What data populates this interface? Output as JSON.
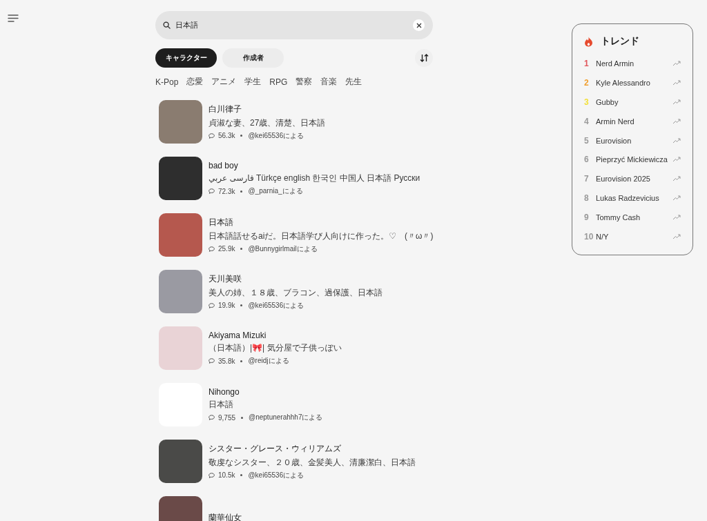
{
  "search": {
    "value": "日本語"
  },
  "tabs": [
    {
      "label": "キャラクター",
      "selected": true
    },
    {
      "label": "作成者",
      "selected": false
    }
  ],
  "tags": [
    "K-Pop",
    "恋愛",
    "アニメ",
    "学生",
    "RPG",
    "警察",
    "音楽",
    "先生"
  ],
  "characters": [
    {
      "name": "白川律子",
      "description": "貞淑な妻、27歳、清楚、日本語",
      "chats": "56.3k",
      "author": "@kei65536による",
      "color": "#8a7c70"
    },
    {
      "name": "bad boy",
      "description": "فارسی عربي Türkçe english 한국인 中国人 日本語 Русски",
      "chats": "72.3k",
      "author": "@_parnia_による",
      "color": "#2e2e2e"
    },
    {
      "name": "日本語",
      "description": "日本語話せるaiだ。日本語学び人向けに作った。♡　(〃ω〃)",
      "chats": "25.9k",
      "author": "@Bunnygirlmailによる",
      "color": "#b5584e"
    },
    {
      "name": "天川美咲",
      "description": "美人の姉、１８歳、ブラコン、過保護、日本語",
      "chats": "19.9k",
      "author": "@kei65536による",
      "color": "#9a9aa2"
    },
    {
      "name": "Akiyama Mizuki",
      "description": "（日本語）|🎀| 気分屋で子供っぽい",
      "chats": "35.8k",
      "author": "@reidjによる",
      "color": "#e9d3d6"
    },
    {
      "name": "Nihongo",
      "description": "日本語",
      "chats": "9,755",
      "author": "@neptunerahhh7による",
      "color": "#ffffff"
    },
    {
      "name": "シスター・グレース・ウィリアムズ",
      "description": "敬虔なシスター、２０歳、金髪美人、清廉潔白、日本語",
      "chats": "10.5k",
      "author": "@kei65536による",
      "color": "#4a4a48"
    },
    {
      "name": "蘭華仙女",
      "color": "#6a4a48"
    }
  ],
  "trends": {
    "title": "トレンド",
    "items": [
      {
        "rank": "1",
        "name": "Nerd Armin",
        "color": "#e0565b"
      },
      {
        "rank": "2",
        "name": "Kyle Alessandro",
        "color": "#f0a030"
      },
      {
        "rank": "3",
        "name": "Gubby",
        "color": "#f2e03a"
      },
      {
        "rank": "4",
        "name": "Armin Nerd",
        "color": "#9a9a9a"
      },
      {
        "rank": "5",
        "name": "Eurovision",
        "color": "#9a9a9a"
      },
      {
        "rank": "6",
        "name": "Pieprzyć Mickiewicza",
        "color": "#9a9a9a"
      },
      {
        "rank": "7",
        "name": "Eurovision 2025",
        "color": "#9a9a9a"
      },
      {
        "rank": "8",
        "name": "Lukas Radzevicius",
        "color": "#9a9a9a"
      },
      {
        "rank": "9",
        "name": "Tommy Cash",
        "color": "#9a9a9a"
      },
      {
        "rank": "10",
        "name": "N/Y",
        "color": "#9a9a9a"
      }
    ]
  }
}
